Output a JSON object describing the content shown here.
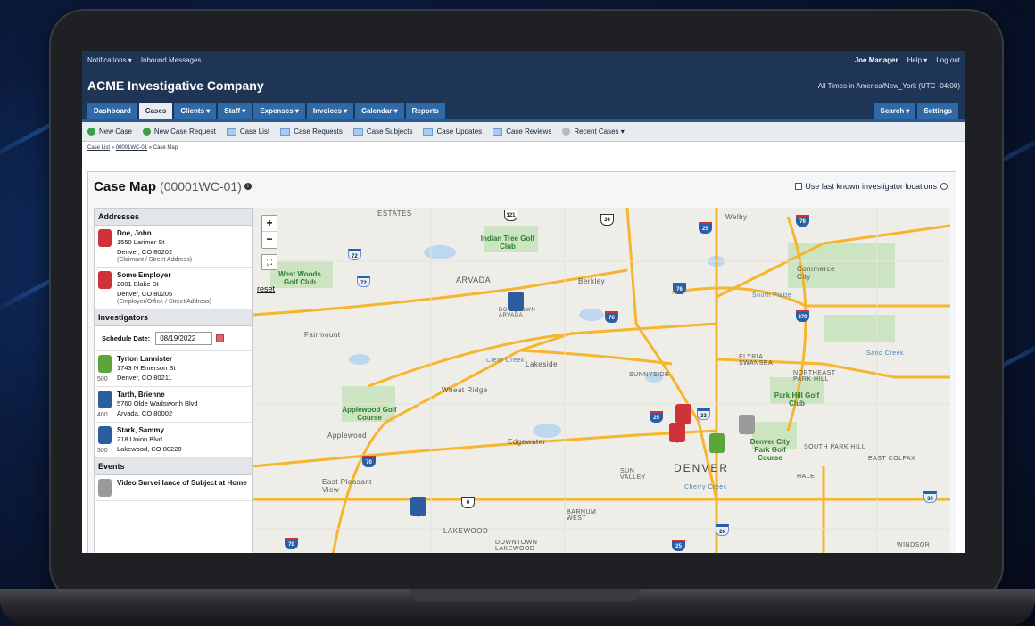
{
  "topbar": {
    "notifications": "Notifications ▾",
    "inbound": "Inbound Messages",
    "user": "Joe Manager",
    "help": "Help ▾",
    "logout": "Log out"
  },
  "header": {
    "title": "ACME Investigative Company",
    "timezone": "All Times in America/New_York (UTC -04:00)"
  },
  "nav": {
    "tabs": [
      "Dashboard",
      "Cases",
      "Clients ▾",
      "Staff ▾",
      "Expenses ▾",
      "Invoices ▾",
      "Calendar ▾",
      "Reports"
    ],
    "active": "Cases",
    "search": "Search ▾",
    "settings": "Settings"
  },
  "subnav": {
    "new_case": "New Case",
    "new_case_request": "New Case Request",
    "case_list": "Case List",
    "case_requests": "Case Requests",
    "case_subjects": "Case Subjects",
    "case_updates": "Case Updates",
    "case_reviews": "Case Reviews",
    "recent_cases": "Recent Cases ▾"
  },
  "breadcrumb": {
    "case_list": "Case List",
    "case_id": "00001WC-01",
    "current": "» Case Map",
    "sep": "»"
  },
  "page": {
    "title": "Case Map",
    "case_id": "(00001WC-01)",
    "last_known": "Use last known investigator locations"
  },
  "sidebar": {
    "addresses_header": "Addresses",
    "addresses": [
      {
        "name": "Doe, John",
        "line1": "1550 Larimer St",
        "line2": "Denver, CO 80202",
        "type": "(Claimant / Street Address)"
      },
      {
        "name": "Some Employer",
        "line1": "2001 Blake St",
        "line2": "Denver, CO 80205",
        "type": "(Employer/Office / Street Address)"
      }
    ],
    "investigators_header": "Investigators",
    "schedule_label": "Schedule Date:",
    "schedule_date": "08/19/2022",
    "investigators": [
      {
        "name": "Tyrion Lannister",
        "line1": "1743 N Emerson St",
        "line2": "Denver, CO 80211",
        "num": "500"
      },
      {
        "name": "Tarth, Brienne",
        "line1": "5760 Olde Wadsworth Blvd",
        "line2": "Arvada, CO 80002",
        "num": "400"
      },
      {
        "name": "Stark, Sammy",
        "line1": "218 Union Blvd",
        "line2": "Lakewood, CO 80228",
        "num": "300"
      }
    ],
    "events_header": "Events",
    "events": [
      {
        "name": "Video Surveillance of Subject at Home"
      }
    ]
  },
  "map": {
    "zoom_in": "+",
    "zoom_out": "−",
    "fullscreen": "⛶",
    "reset": "reset",
    "places": [
      "ESTATES",
      "Welby",
      "ARVADA",
      "Berkley",
      "Commerce City",
      "Fairmount",
      "Lakeside",
      "SUNNYSIDE",
      "ELYRIA SWANSEA",
      "NORTHEAST PARK HILL",
      "Wheat Ridge",
      "Applewood",
      "Edgewater",
      "DENVER",
      "SOUTH PARK HILL",
      "EAST COLFAX",
      "HALE",
      "East Pleasant View",
      "SUN VALLEY",
      "BARNUM WEST",
      "LAKEWOOD",
      "DOWNTOWN LAKEWOOD",
      "WINDSOR",
      "DOWNTOWN ARVADA",
      "Clear Creek",
      "Sand Creek",
      "Cherry Creek",
      "South Platte"
    ],
    "parks": [
      "Indian Tree Golf Club",
      "West Woods Golf Club",
      "Applewood Golf Course",
      "Park Hill Golf Club",
      "Denver City Park Golf Course"
    ],
    "highways": [
      "121",
      "36",
      "25",
      "76",
      "72",
      "72",
      "76",
      "76",
      "270",
      "70",
      "25",
      "33",
      "6",
      "70",
      "26",
      "25",
      "30"
    ]
  }
}
